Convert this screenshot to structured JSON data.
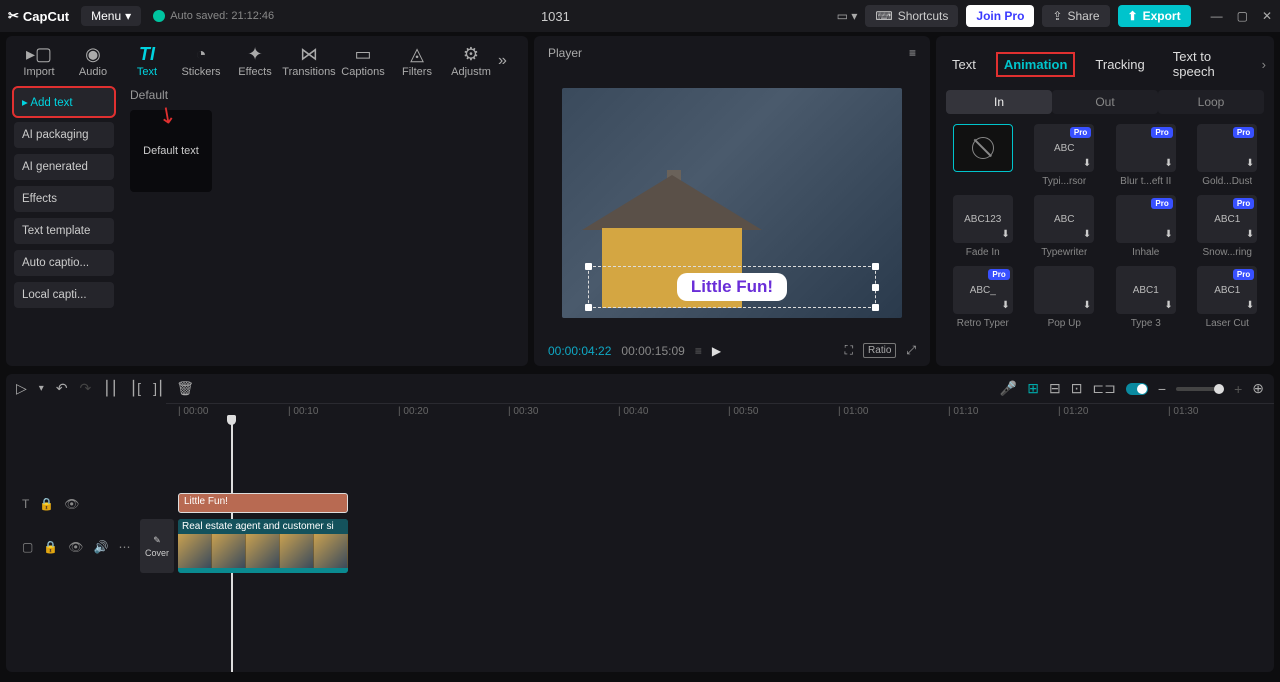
{
  "titlebar": {
    "app": "CapCut",
    "menu": "Menu",
    "autosave": "Auto saved: 21:12:46",
    "project": "1031",
    "shortcuts": "Shortcuts",
    "joinpro": "Join Pro",
    "share": "Share",
    "export": "Export"
  },
  "tabs": {
    "import": "Import",
    "audio": "Audio",
    "text": "Text",
    "stickers": "Stickers",
    "effects": "Effects",
    "transitions": "Transitions",
    "captions": "Captions",
    "filters": "Filters",
    "adjustm": "Adjustm"
  },
  "side": {
    "add_text": "Add text",
    "ai_packaging": "AI packaging",
    "ai_generated": "AI generated",
    "effects": "Effects",
    "text_template": "Text template",
    "auto_captions": "Auto captio...",
    "local_captions": "Local capti..."
  },
  "content": {
    "section": "Default",
    "default_text": "Default text"
  },
  "player": {
    "label": "Player",
    "text_overlay": "Little Fun!",
    "time_current": "00:00:04:22",
    "time_duration": "00:00:15:09",
    "ratio": "Ratio"
  },
  "right": {
    "tabs": {
      "text": "Text",
      "animation": "Animation",
      "tracking": "Tracking",
      "tts": "Text to speech"
    },
    "subtabs": {
      "in": "In",
      "out": "Out",
      "loop": "Loop"
    },
    "anims": [
      {
        "label": "",
        "pro": false,
        "none": true
      },
      {
        "label": "Typi...rsor",
        "pro": true,
        "txt": "ABC"
      },
      {
        "label": "Blur t...eft II",
        "pro": true,
        "txt": ""
      },
      {
        "label": "Gold...Dust",
        "pro": true,
        "txt": ""
      },
      {
        "label": "Fade In",
        "pro": false,
        "txt": "ABC123"
      },
      {
        "label": "Typewriter",
        "pro": false,
        "txt": "ABC"
      },
      {
        "label": "Inhale",
        "pro": true,
        "txt": ""
      },
      {
        "label": "Snow...ring",
        "pro": true,
        "txt": "ABC1"
      },
      {
        "label": "Retro Typer",
        "pro": true,
        "txt": "ABC_"
      },
      {
        "label": "Pop Up",
        "pro": false,
        "txt": ""
      },
      {
        "label": "Type 3",
        "pro": false,
        "txt": "ABC1"
      },
      {
        "label": "Laser Cut",
        "pro": true,
        "txt": "ABC1"
      }
    ]
  },
  "timeline": {
    "ticks": [
      "00:00",
      "00:10",
      "00:20",
      "00:30",
      "00:40",
      "00:50",
      "01:00",
      "01:10",
      "01:20",
      "01:30"
    ],
    "text_clip": "Little Fun!",
    "video_clip": "Real estate agent and customer si",
    "cover": "Cover"
  }
}
